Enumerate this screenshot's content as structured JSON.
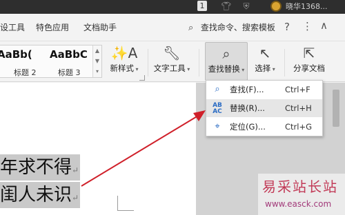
{
  "titlebar": {
    "badge_number": "1",
    "user_name": "晓华1368..."
  },
  "menubar": {
    "items": [
      "设工具",
      "特色应用",
      "文档助手"
    ],
    "search_commands": "查找命令、搜索模板",
    "help_glyph": "?",
    "more_glyph": "⋮",
    "collapse_glyph": "∧"
  },
  "ribbon": {
    "styles": [
      {
        "sample": "AaBb(",
        "label": "标题 2"
      },
      {
        "sample": "AaBbC",
        "label": "标题 3"
      }
    ],
    "buttons": {
      "new_style": "新样式",
      "text_tools": "文字工具",
      "find_replace": "查找替换",
      "select": "选择",
      "share_doc": "分享文档"
    }
  },
  "dropdown": {
    "items": [
      {
        "label": "查找(F)...",
        "shortcut": "Ctrl+F",
        "icon": "search-icon"
      },
      {
        "label": "替换(R)...",
        "shortcut": "Ctrl+H",
        "icon": "replace-icon"
      },
      {
        "label": "定位(G)...",
        "shortcut": "Ctrl+G",
        "icon": "locate-icon"
      }
    ]
  },
  "document": {
    "lines": [
      "年求不得",
      "闺人未识"
    ],
    "paragraph_mark": "↵"
  },
  "watermark": {
    "site_name": "易采站长站",
    "url": "www.easck.com"
  },
  "colors": {
    "arrow": "#d0202a",
    "accent_blue": "#2b6cc4",
    "titlebar": "#2e2e2e"
  }
}
